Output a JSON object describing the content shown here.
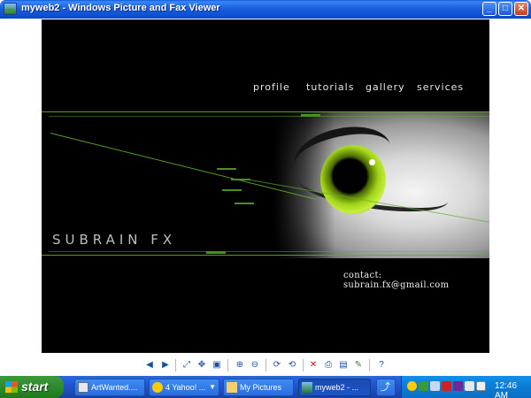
{
  "window": {
    "title": "myweb2 - Windows Picture and Fax Viewer",
    "buttons": {
      "minimize": "_",
      "maximize": "□",
      "close": "✕"
    }
  },
  "webpage": {
    "nav": [
      "profile",
      "tutorials",
      "gallery",
      "services"
    ],
    "brand": "SUBRAIN FX",
    "contact": "contact: subrain.fx@gmail.com",
    "colors": {
      "background": "#000000",
      "accent_green": "#5fae2f",
      "iris": "#a2d41c"
    }
  },
  "toolbar": {
    "icons": [
      "previous-image-icon",
      "next-image-icon",
      "best-fit-icon",
      "actual-size-icon",
      "slideshow-icon",
      "zoom-in-icon",
      "zoom-out-icon",
      "rotate-clockwise-icon",
      "rotate-counterclockwise-icon",
      "delete-icon",
      "print-icon",
      "save-icon",
      "edit-icon",
      "help-icon"
    ]
  },
  "taskbar": {
    "start_label": "start",
    "tasks": [
      {
        "label": "ArtWanted....",
        "icon": "browser-icon",
        "active": false
      },
      {
        "label": "4 Yahoo! ...",
        "icon": "yahoo-messenger-icon",
        "active": false
      },
      {
        "label": "My Pictures",
        "icon": "folder-icon",
        "active": false
      },
      {
        "label": "myweb2 - ...",
        "icon": "picture-viewer-icon",
        "active": true
      }
    ],
    "clock": "12:46 AM"
  }
}
